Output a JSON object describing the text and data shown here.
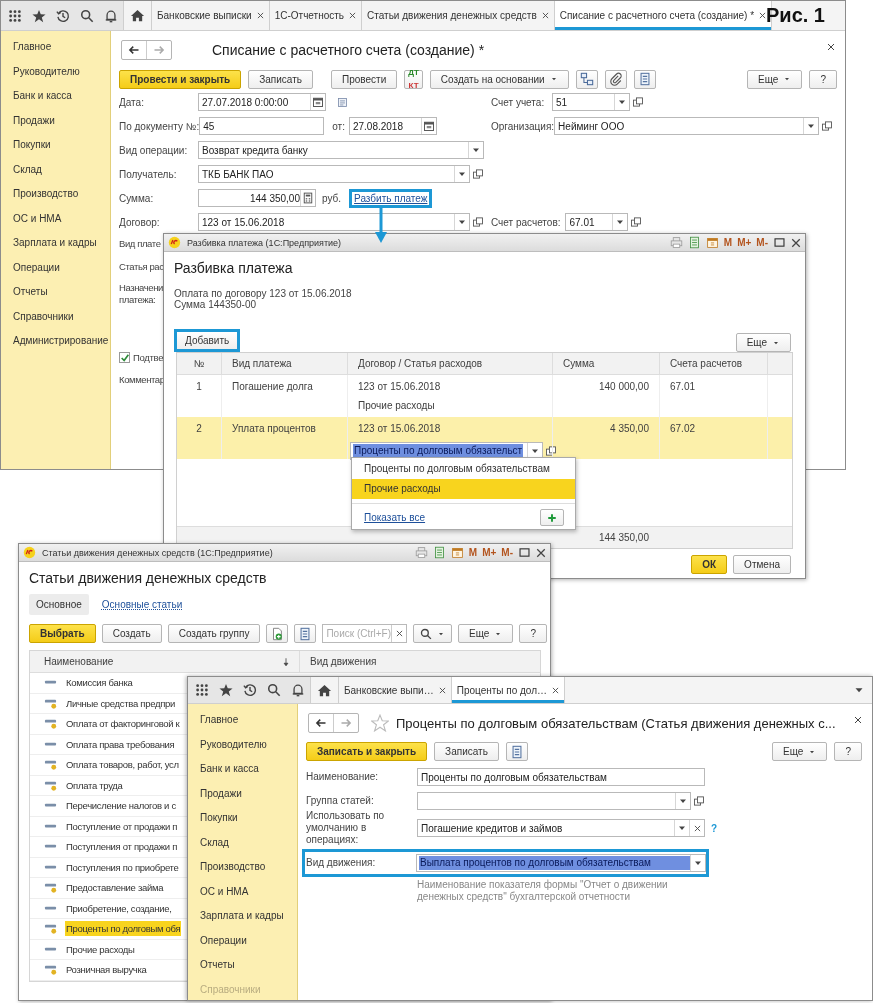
{
  "figure_label": "Рис. 1",
  "main_window": {
    "tabs": [
      {
        "label": "Банковские выписки",
        "selected": false
      },
      {
        "label": "1С-Отчетность",
        "selected": false
      },
      {
        "label": "Статьи движения денежных средств",
        "selected": false
      },
      {
        "label": "Списание с расчетного счета (создание) *",
        "selected": true
      }
    ],
    "sidebar": [
      "Главное",
      "Руководителю",
      "Банк и касса",
      "Продажи",
      "Покупки",
      "Склад",
      "Производство",
      "ОС и НМА",
      "Зарплата и кадры",
      "Операции",
      "Отчеты",
      "Справочники",
      "Администрирование"
    ],
    "title": "Списание с расчетного счета (создание) *",
    "toolbar": {
      "post_close": "Провести и закрыть",
      "save": "Записать",
      "post": "Провести",
      "dt_kt": [
        "ДТ",
        "КТ"
      ],
      "create_based": "Создать на основании",
      "more": "Еще",
      "help": "?"
    },
    "form": {
      "date_label": "Дата:",
      "date_value": "27.07.2018  0:00:00",
      "account_label": "Счет учета:",
      "account_value": "51",
      "doc_no_label": "По документу №:",
      "doc_no_value": "45",
      "doc_date_label": "от:",
      "doc_date_value": "27.08.2018",
      "org_label": "Организация:",
      "org_value": "Нейминг ООО",
      "operation_label": "Вид операции:",
      "operation_value": "Возврат кредита банку",
      "recipient_label": "Получатель:",
      "recipient_value": "ТКБ БАНК ПАО",
      "amount_label": "Сумма:",
      "amount_value": "144 350,00",
      "currency": "руб.",
      "split_link": {
        "label": "Разбить платеж",
        "highlighted": true
      },
      "contract_label": "Договор:",
      "contract_value": "123 от 15.06.2018",
      "settlement_label": "Счет расчетов:",
      "settlement_value": "67.01",
      "partial_labels": [
        "Вид плате",
        "Статья рас",
        "Назначени\nплатежа:"
      ],
      "confirm": {
        "label": "Подтве",
        "checked": true
      },
      "comment_label": "Комментар"
    }
  },
  "split_dialog": {
    "title_bar": "Разбивка платежа  (1С:Предприятие)",
    "memory_buttons": [
      "M",
      "M+",
      "M-"
    ],
    "heading": "Разбивка платежа",
    "info_lines": [
      "Оплата по договору 123 от 15.06.2018",
      "Сумма 144350-00"
    ],
    "add_button": {
      "label": "Добавить",
      "highlighted": true
    },
    "more": "Еще",
    "columns": [
      "№",
      "Вид платежа",
      "Договор / Статья расходов",
      "Сумма",
      "Счета расчетов"
    ],
    "rows": [
      {
        "number": "1",
        "payment_type": "Погашение долга",
        "contract": "123 от 15.06.2018",
        "article": "Прочие расходы",
        "amount": "140 000,00",
        "account": "67.01",
        "selected": false,
        "editing": false
      },
      {
        "number": "2",
        "payment_type": "Уплата процентов",
        "contract": "123 от 15.06.2018",
        "article": "Проценты по долговым обязательст",
        "amount": "4 350,00",
        "account": "67.02",
        "selected": true,
        "editing": true
      }
    ],
    "total_amount": "144 350,00",
    "dropdown": {
      "items": [
        {
          "label": "Проценты по долговым обязательствам",
          "selected": false
        },
        {
          "label": "Прочие расходы",
          "selected": true
        }
      ],
      "show_all": "Показать все"
    },
    "ok": "ОК",
    "cancel": "Отмена"
  },
  "articles_window": {
    "title_bar": "Статьи движения денежных средств  (1С:Предприятие)",
    "memory_buttons": [
      "M",
      "M+",
      "M-"
    ],
    "heading": "Статьи движения денежных средств",
    "tabs": [
      {
        "label": "Основное",
        "selected": true
      },
      {
        "label": "Основные статьи",
        "selected": false
      }
    ],
    "toolbar": {
      "select": "Выбрать",
      "create": "Создать",
      "create_group": "Создать группу",
      "search_placeholder": "Поиск (Ctrl+F)",
      "more": "Еще",
      "help": "?"
    },
    "columns": [
      "Наименование",
      "Вид движения"
    ],
    "rows": [
      {
        "name": "Комиссия банка",
        "kind": "plain",
        "selected": false
      },
      {
        "name": "Личные средства предпри",
        "kind": "marked",
        "selected": false
      },
      {
        "name": "Оплата от факторинговой к",
        "kind": "marked",
        "selected": false
      },
      {
        "name": "Оплата права требования",
        "kind": "plain",
        "selected": false
      },
      {
        "name": "Оплата товаров, работ, усл",
        "kind": "marked",
        "selected": false
      },
      {
        "name": "Оплата труда",
        "kind": "marked",
        "selected": false
      },
      {
        "name": "Перечисление налогов и с",
        "kind": "plain",
        "selected": false
      },
      {
        "name": "Поступление от продажи п",
        "kind": "plain",
        "selected": false
      },
      {
        "name": "Поступления от продажи п",
        "kind": "plain",
        "selected": false
      },
      {
        "name": "Поступления по приобрете",
        "kind": "plain",
        "selected": false
      },
      {
        "name": "Предоставление займа",
        "kind": "marked",
        "selected": false
      },
      {
        "name": "Приобретение, создание,",
        "kind": "plain",
        "selected": false
      },
      {
        "name": "Проценты по долговым обя",
        "kind": "marked",
        "selected": true
      },
      {
        "name": "Прочие расходы",
        "kind": "plain",
        "selected": false
      },
      {
        "name": "Розничная выручка",
        "kind": "marked",
        "selected": false
      }
    ]
  },
  "article_window": {
    "tabs": [
      {
        "label": "Банковские выпи…",
        "selected": false
      },
      {
        "label": "Проценты по дол…",
        "selected": true
      }
    ],
    "sidebar": [
      {
        "label": "Главное",
        "faded": false
      },
      {
        "label": "Руководителю",
        "faded": false
      },
      {
        "label": "Банк и касса",
        "faded": false
      },
      {
        "label": "Продажи",
        "faded": false
      },
      {
        "label": "Покупки",
        "faded": false
      },
      {
        "label": "Склад",
        "faded": false
      },
      {
        "label": "Производство",
        "faded": false
      },
      {
        "label": "ОС и НМА",
        "faded": false
      },
      {
        "label": "Зарплата и кадры",
        "faded": false
      },
      {
        "label": "Операции",
        "faded": false
      },
      {
        "label": "Отчеты",
        "faded": false
      },
      {
        "label": "Справочники",
        "faded": true
      }
    ],
    "title": "Проценты по долговым обязательствам (Статья движения денежных с...",
    "toolbar": {
      "save_close": "Записать и закрыть",
      "save": "Записать",
      "more": "Еще",
      "help": "?"
    },
    "form": {
      "name_label": "Наименование:",
      "name_value": "Проценты по долговым обязательствам",
      "group_label": "Группа статей:",
      "default_label": "Использовать по\nумолчанию в операциях:",
      "default_value": "Погашение кредитов и займов",
      "help_mark": "?",
      "movement_label": "Вид движения:",
      "movement_value": "Выплата процентов по долговым обязательствам",
      "movement_highlighted": true,
      "hint": "Наименование показателя формы \"Отчет о движении денежных средств\" бухгалтерской отчетности"
    }
  }
}
